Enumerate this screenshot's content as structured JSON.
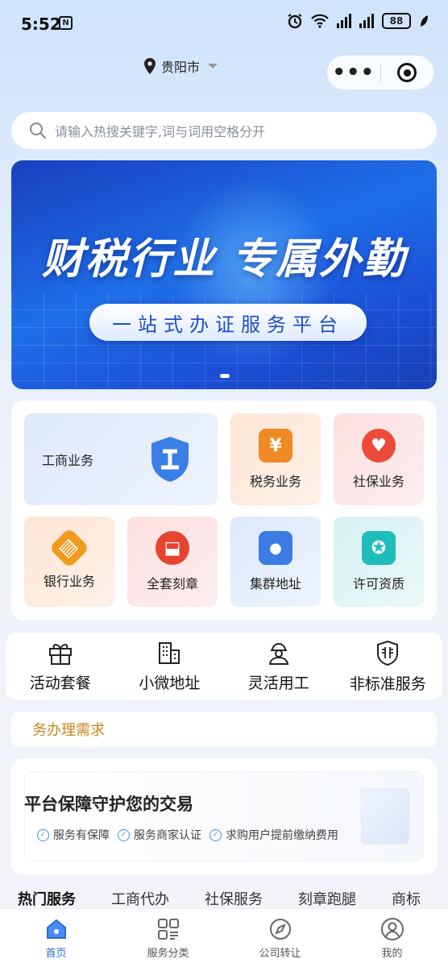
{
  "status_bar": {
    "time": "5:52",
    "nfc": "N",
    "battery": "88"
  },
  "header": {
    "city": "贵阳市",
    "more_button": "•••"
  },
  "search": {
    "placeholder": "请输入热搜关键字,词与词用空格分开"
  },
  "banner": {
    "title": "财税行业  专属外勤",
    "subtitle": "一站式办证服务平台"
  },
  "services": [
    {
      "label": "工商业务",
      "icon": "shield-gong-icon",
      "glyph": "工",
      "color": "#3a7ee8"
    },
    {
      "label": "税务业务",
      "icon": "yen-icon",
      "glyph": "¥",
      "color": "#f08a24"
    },
    {
      "label": "社保业务",
      "icon": "heart-hand-icon",
      "glyph": "♥",
      "color": "#ec4b3a"
    },
    {
      "label": "银行业务",
      "icon": "bank-icon",
      "glyph": "▥",
      "color": "#f29a1e"
    },
    {
      "label": "全套刻章",
      "icon": "stamp-icon",
      "glyph": "⬓",
      "color": "#e8432e"
    },
    {
      "label": "集群地址",
      "icon": "location-pin-icon",
      "glyph": "●",
      "color": "#3b7be3"
    },
    {
      "label": "许可资质",
      "icon": "certificate-icon",
      "glyph": "✪",
      "color": "#1fbcbc"
    }
  ],
  "quick_nav": [
    {
      "label": "活动套餐",
      "icon": "gift-icon"
    },
    {
      "label": "小微地址",
      "icon": "building-icon"
    },
    {
      "label": "灵活用工",
      "icon": "worker-icon"
    },
    {
      "label": "非标准服务",
      "icon": "fei-shield-icon"
    }
  ],
  "demand": {
    "text": "务办理需求"
  },
  "guarantee": {
    "title": "平台保障守护您的交易",
    "points": [
      "服务有保障",
      "服务商家认证",
      "求购用户提前缴纳费用"
    ]
  },
  "hot_tabs": [
    "热门服务",
    "工商代办",
    "社保服务",
    "刻章跑腿",
    "商标"
  ],
  "tabbar": [
    {
      "label": "首页",
      "icon": "home-icon",
      "active": true
    },
    {
      "label": "服务分类",
      "icon": "grid-icon",
      "active": false
    },
    {
      "label": "公司转让",
      "icon": "compass-icon",
      "active": false
    },
    {
      "label": "我的",
      "icon": "user-icon",
      "active": false
    }
  ],
  "colors": {
    "accent": "#2a6fdb",
    "demand_text": "#c9861c",
    "banner": "#1f6fe8"
  }
}
